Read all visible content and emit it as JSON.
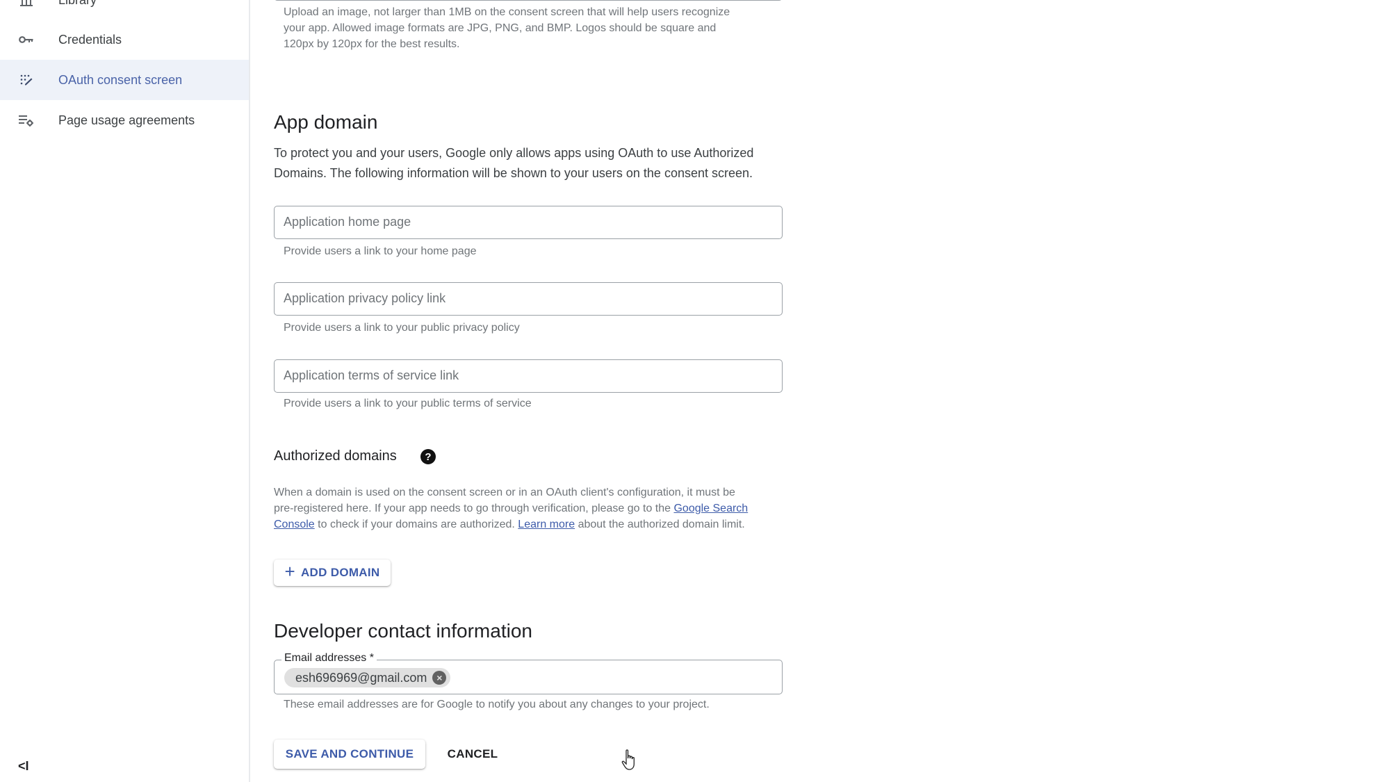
{
  "sidebar": {
    "items": [
      {
        "label": "Library",
        "icon": "library-icon",
        "active": false
      },
      {
        "label": "Credentials",
        "icon": "key-icon",
        "active": false
      },
      {
        "label": "OAuth consent screen",
        "icon": "consent-icon",
        "active": true
      },
      {
        "label": "Page usage agreements",
        "icon": "settings-list-icon",
        "active": false
      }
    ],
    "collapse_icon": "<I"
  },
  "logo_section": {
    "help_lines": [
      "Upload an image, not larger than 1MB on the consent screen that will help users recognize",
      "your app. Allowed image formats are JPG, PNG, and BMP. Logos should be square and",
      "120px by 120px for the best results."
    ]
  },
  "app_domain": {
    "title": "App domain",
    "description_lines": [
      "To protect you and your users, Google only allows apps using OAuth to use Authorized",
      "Domains. The following information will be shown to your users on the consent screen."
    ],
    "fields": [
      {
        "placeholder": "Application home page",
        "value": "",
        "helper": "Provide users a link to your home page"
      },
      {
        "placeholder": "Application privacy policy link",
        "value": "",
        "helper": "Provide users a link to your public privacy policy"
      },
      {
        "placeholder": "Application terms of service link",
        "value": "",
        "helper": "Provide users a link to your public terms of service"
      }
    ]
  },
  "authorized_domains": {
    "title": "Authorized domains",
    "help_icon": "?",
    "line1": "When a domain is used on the consent screen or in an OAuth client's configuration, it must be",
    "line2_prefix": "pre-registered here. If your app needs to go through verification, please go to the ",
    "link_search_console_a": "Google Search",
    "link_search_console_b": "Console",
    "line3_mid": " to check if your domains are authorized. ",
    "link_learn_more": "Learn more",
    "line3_suffix": " about the authorized domain limit.",
    "add_button": "ADD DOMAIN",
    "add_icon": "+"
  },
  "developer_contact": {
    "title": "Developer contact information",
    "email_label": "Email addresses *",
    "emails": [
      "esh696969@gmail.com"
    ],
    "remove_icon": "×",
    "helper": "These email addresses are for Google to notify you about any changes to your project."
  },
  "actions": {
    "save": "SAVE AND CONTINUE",
    "cancel": "CANCEL"
  },
  "colors": {
    "accent": "#3d5ba9",
    "active_bg": "#eef2f9"
  }
}
